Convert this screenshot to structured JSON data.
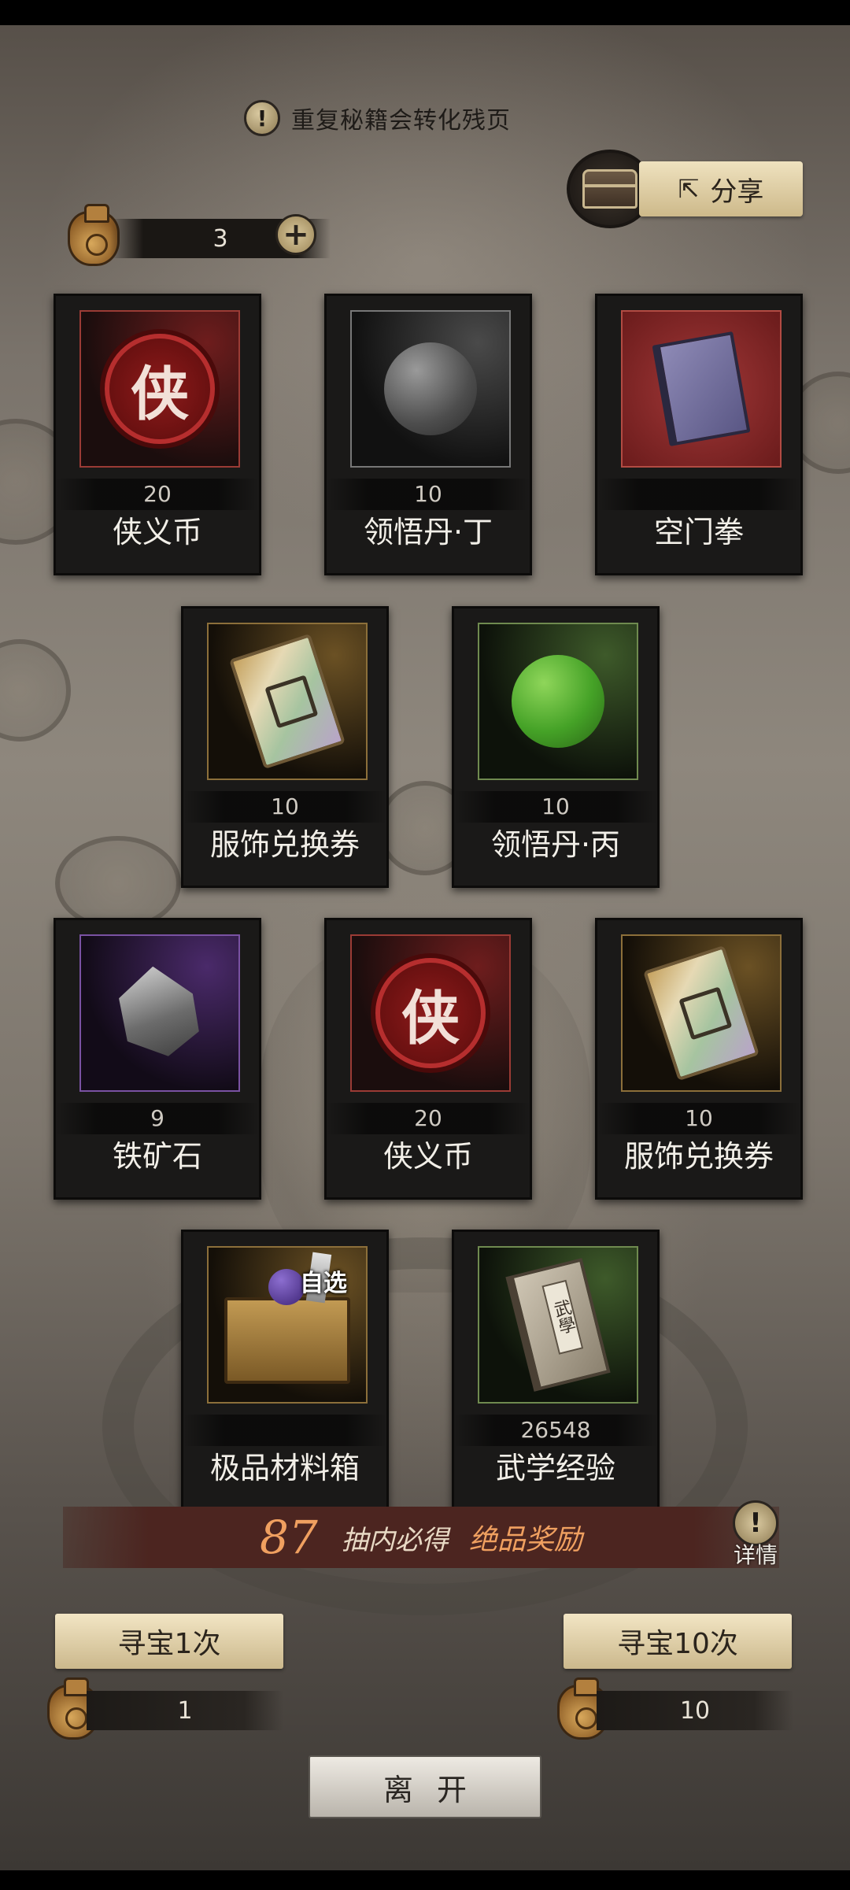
{
  "notice": {
    "text": "重复秘籍会转化残页"
  },
  "share": {
    "label": "分享"
  },
  "currency": {
    "amount": "3"
  },
  "items": [
    {
      "count": "20",
      "name": "侠义币",
      "art": "coin-icon"
    },
    {
      "count": "10",
      "name": "领悟丹·丁",
      "art": "gray-orb-icon"
    },
    {
      "count": "",
      "name": "空门拳",
      "art": "book-icon"
    },
    {
      "count": "10",
      "name": "服饰兑换券",
      "art": "ticket-icon"
    },
    {
      "count": "10",
      "name": "领悟丹·丙",
      "art": "green-orb-icon"
    },
    {
      "count": "9",
      "name": "铁矿石",
      "art": "ore-icon"
    },
    {
      "count": "20",
      "name": "侠义币",
      "art": "coin-icon"
    },
    {
      "count": "10",
      "name": "服饰兑换券",
      "art": "ticket-icon"
    },
    {
      "count": "",
      "name": "极品材料箱",
      "art": "chest-icon",
      "tag": "自选"
    },
    {
      "count": "26548",
      "name": "武学经验",
      "art": "old-book-icon",
      "book_title": "武學"
    }
  ],
  "coin_glyph": "侠",
  "banner": {
    "number": "87",
    "text": "抽内必得",
    "reward": "绝品奖励",
    "detail_label": "详情"
  },
  "draw_once": {
    "label": "寻宝1次",
    "cost": "1"
  },
  "draw_ten": {
    "label": "寻宝10次",
    "cost": "10"
  },
  "leave": {
    "label": "离开"
  }
}
